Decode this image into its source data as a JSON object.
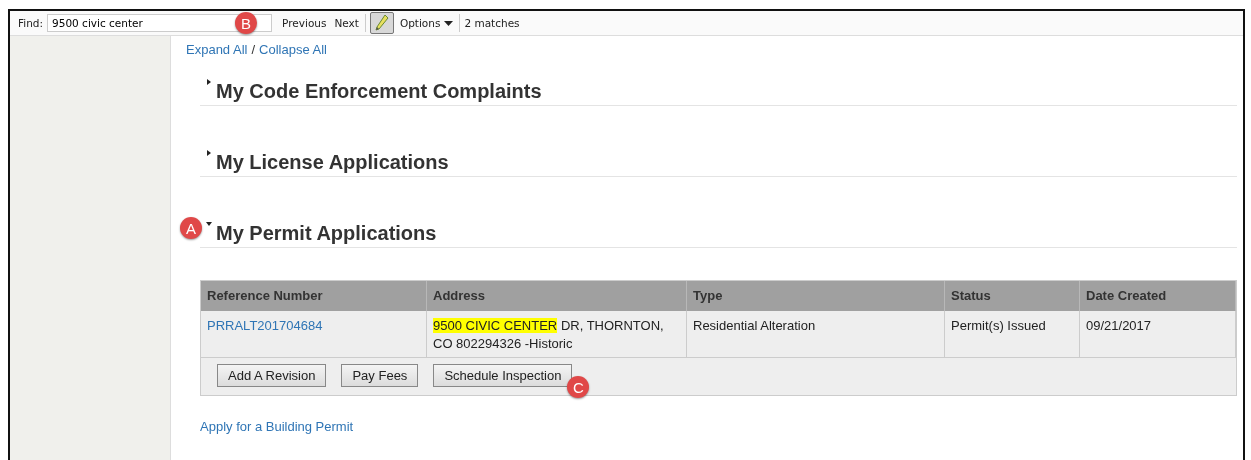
{
  "find_bar": {
    "label": "Find:",
    "value": "9500 civic center",
    "callout": "B",
    "previous": "Previous",
    "next": "Next",
    "highlight_on": true,
    "options": "Options",
    "matches": "2 matches"
  },
  "expand_all": "Expand All",
  "separator": "/",
  "collapse_all": "Collapse All",
  "sections": [
    {
      "title": "My Code Enforcement Complaints",
      "expanded": false
    },
    {
      "title": "My License Applications",
      "expanded": false
    },
    {
      "title": "My Permit Applications",
      "expanded": true,
      "callout": "A"
    }
  ],
  "table": {
    "columns": [
      "Reference Number",
      "Address",
      "Type",
      "Status",
      "Date Created"
    ],
    "rows": [
      {
        "reference": "PRRALT201704684",
        "address_match": "9500 CIVIC CENTER",
        "address_rest": "DR, THORNTON, CO 802294326 -Historic",
        "type": "Residential Alteration",
        "status": "Permit(s) Issued",
        "date": "09/21/2017"
      }
    ],
    "actions": [
      {
        "label": "Add A Revision"
      },
      {
        "label": "Pay Fees"
      },
      {
        "label": "Schedule Inspection",
        "callout": "C"
      }
    ]
  },
  "apply_link": "Apply for a Building Permit"
}
